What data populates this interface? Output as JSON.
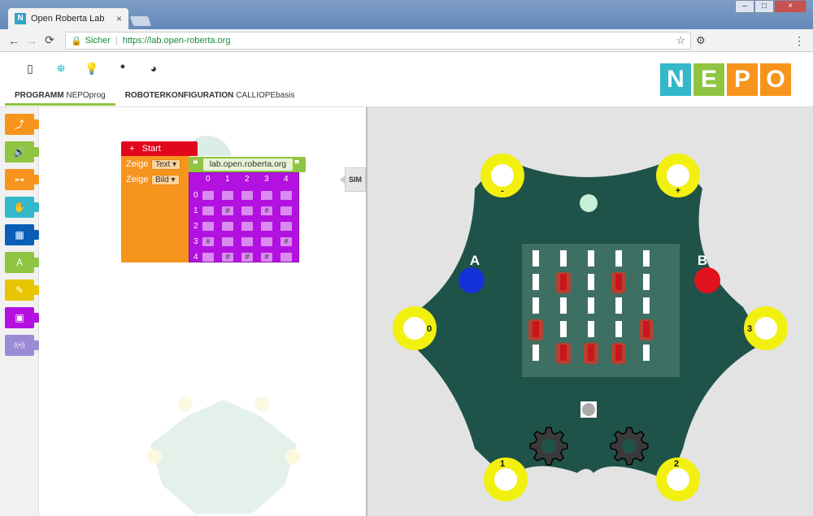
{
  "browser": {
    "tab_title": "Open Roberta Lab",
    "tab_favicon": "N",
    "tab_close": "×",
    "secure_label": "Sicher",
    "url": "https://lab.open-roberta.org",
    "win_min": "–",
    "win_max": "□",
    "win_close": "×",
    "back_glyph": "←",
    "forward_glyph": "→",
    "reload_glyph": "⟳",
    "lock_glyph": "🔒",
    "star_glyph": "☆",
    "ext_glyph": "⚙",
    "menu_glyph": "⋮"
  },
  "app": {
    "top_icons": [
      "program-icon",
      "robot-icon",
      "lightbulb-icon",
      "user-icon",
      "globe-icon"
    ],
    "top_icon_glyphs": [
      "▯",
      "⛯",
      "💡",
      "●",
      "◕"
    ],
    "tab_program_label": "PROGRAMM",
    "tab_program_name": "NEPOprog",
    "tab_config_label": "ROBOTERKONFIGURATION",
    "tab_config_name": "CALLIOPEbasis",
    "logo_letters": [
      "N",
      "E",
      "P",
      "O"
    ],
    "logo_colors": [
      "#33b8ca",
      "#8fc541",
      "#f7941d",
      "#f7941d"
    ]
  },
  "toolbox": {
    "categories": [
      {
        "name": "control",
        "glyph": "⤴",
        "color": "#f7941d"
      },
      {
        "name": "sound",
        "glyph": "🔊",
        "color": "#8fc541"
      },
      {
        "name": "logic",
        "glyph": "⊶",
        "color": "#f7941d"
      },
      {
        "name": "sensors",
        "glyph": "✋",
        "color": "#33b8ca"
      },
      {
        "name": "math",
        "glyph": "▦",
        "color": "#0a5eb7"
      },
      {
        "name": "text",
        "glyph": "A",
        "color": "#8fc541"
      },
      {
        "name": "colour",
        "glyph": "✎",
        "color": "#e8c501"
      },
      {
        "name": "image",
        "glyph": "▣",
        "color": "#b311e0"
      },
      {
        "name": "communication",
        "glyph": "((•))",
        "color": "#9b8bd6"
      }
    ]
  },
  "program": {
    "start_icon": "+",
    "start_label": "Start",
    "show1_label": "Zeige",
    "show1_type": "Text",
    "show2_label": "Zeige",
    "show2_type": "Bild",
    "dropdown_caret": "▾",
    "quote_open": "❝",
    "quote_close": "❞",
    "text_value": "lab.open.roberta.org",
    "image_cols": [
      "0",
      "1",
      "2",
      "3",
      "4"
    ],
    "image_rows": [
      "0",
      "1",
      "2",
      "3",
      "4"
    ],
    "image_grid": [
      [
        "",
        "",
        "",
        "",
        ""
      ],
      [
        "",
        "#",
        "",
        "#",
        ""
      ],
      [
        "",
        "",
        "",
        "",
        ""
      ],
      [
        "#",
        "",
        "",
        "",
        "#"
      ],
      [
        "",
        "#",
        "#",
        "#",
        ""
      ]
    ],
    "sim_label": "SIM"
  },
  "simulation": {
    "pad_labels": {
      "minus": "-",
      "plus": "+",
      "p0": "0",
      "p3": "3",
      "p1": "1",
      "p2": "2"
    },
    "button_a": "A",
    "button_b": "B",
    "button_a_color": "#1432d8",
    "button_b_color": "#e0121e",
    "board_color": "#1f5349",
    "pad_color": "#f2f00e",
    "led_on_color": "#e03221",
    "led_matrix": [
      [
        0,
        0,
        0,
        0,
        0
      ],
      [
        0,
        1,
        0,
        1,
        0
      ],
      [
        0,
        0,
        0,
        0,
        0
      ],
      [
        1,
        0,
        0,
        0,
        1
      ],
      [
        0,
        1,
        1,
        1,
        0
      ]
    ]
  }
}
